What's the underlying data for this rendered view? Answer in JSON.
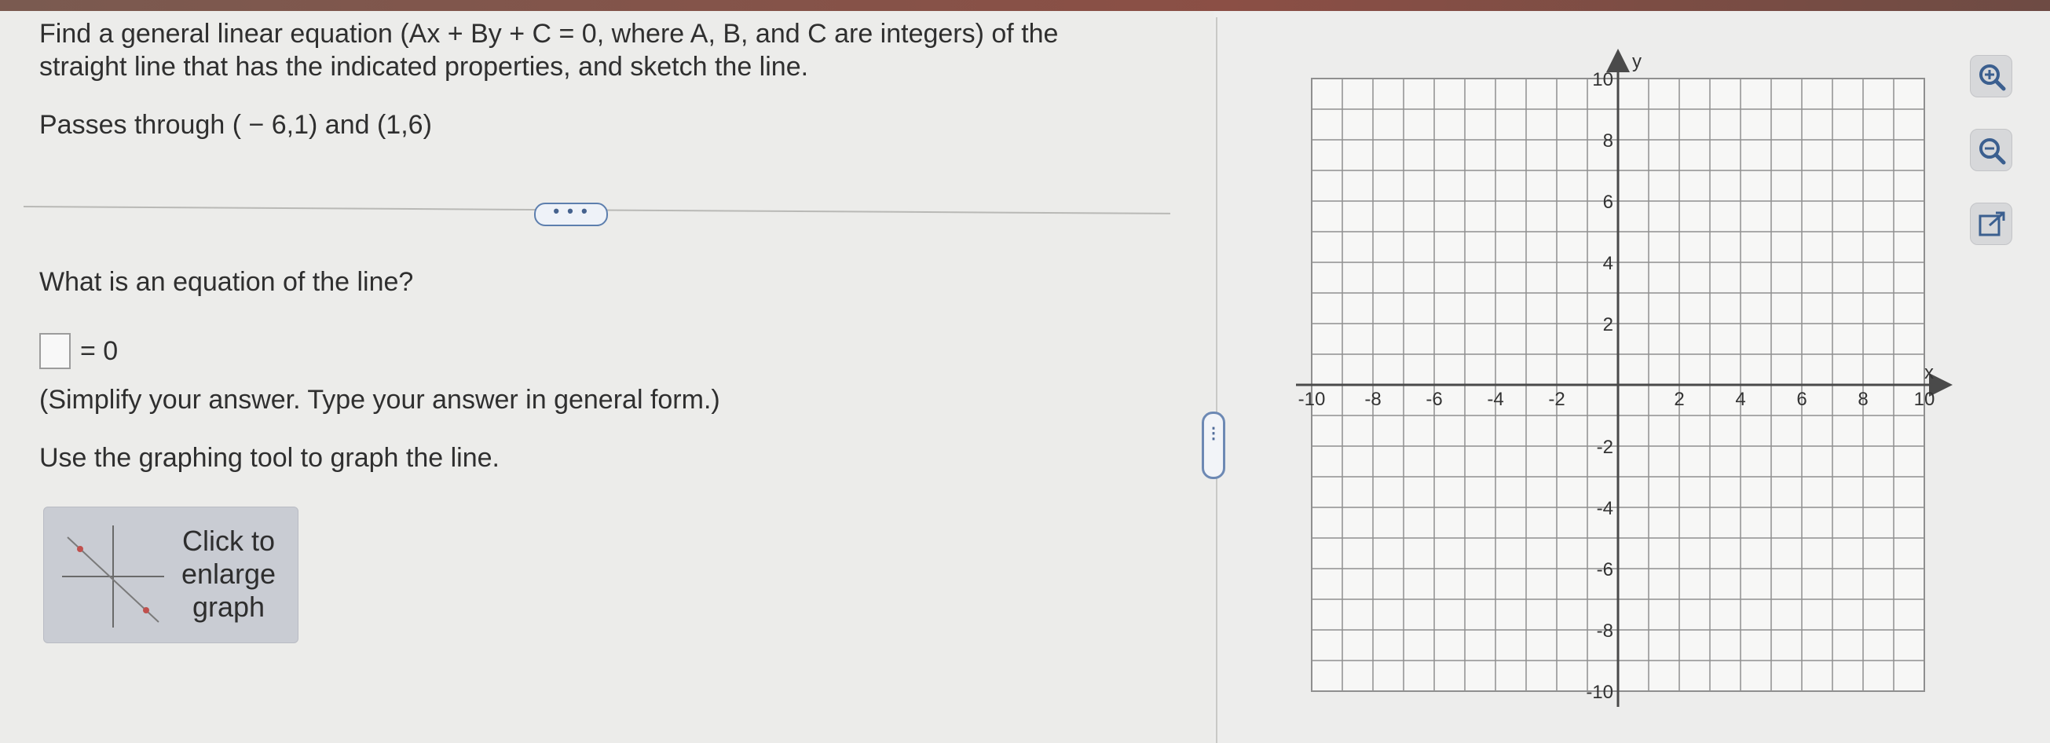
{
  "question": {
    "prompt": "Find a general linear equation (Ax + By + C = 0, where A, B, and C are integers) of the straight line that has the indicated properties, and sketch the line.",
    "passes": "Passes through ( − 6,1) and (1,6)"
  },
  "more_label": "• • •",
  "answer": {
    "question": "What is an equation of the line?",
    "equals": "= 0",
    "value": "",
    "hint": "(Simplify your answer. Type your answer in general form.)",
    "instruction": "Use the graphing tool to graph the line."
  },
  "enlarge": {
    "label": "Click to enlarge graph"
  },
  "collapse_label": "⋮",
  "graph": {
    "x_axis_label": "x",
    "y_axis_label": "y",
    "x_ticks": [
      "-10",
      "-8",
      "-6",
      "-4",
      "-2",
      "2",
      "4",
      "6",
      "8",
      "10"
    ],
    "y_ticks": [
      "10",
      "8",
      "6",
      "4",
      "2",
      "-2",
      "-4",
      "-6",
      "-8",
      "-10"
    ],
    "xlim": [
      -10,
      10
    ],
    "ylim": [
      -10,
      10
    ],
    "grid": true
  },
  "tools": {
    "zoom_in": "zoom-in-icon",
    "zoom_out": "zoom-out-icon",
    "popout": "external-link-icon"
  },
  "colors": {
    "accent": "#5d7fae",
    "grid": "#8f8f8f",
    "axis": "#4a4a4a"
  }
}
